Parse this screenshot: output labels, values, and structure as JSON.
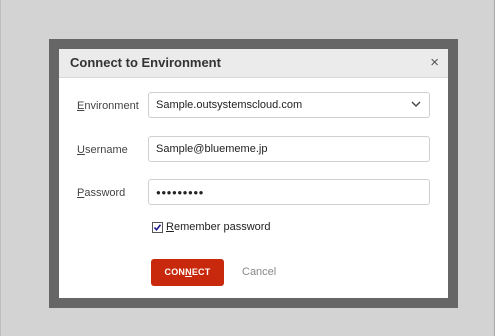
{
  "dialog": {
    "title": "Connect to Environment",
    "close_glyph": "×"
  },
  "form": {
    "environment": {
      "label_underlined": "E",
      "label_rest": "nvironment",
      "value": "Sample.outsystemscloud.com"
    },
    "username": {
      "label_underlined": "U",
      "label_rest": "sername",
      "value": "Sample@bluememe.jp"
    },
    "password": {
      "label_underlined": "P",
      "label_rest": "assword",
      "value": "●●●●●●●●●"
    },
    "remember": {
      "checked": true,
      "label_underlined": "R",
      "label_rest": "emember password"
    }
  },
  "actions": {
    "connect_pre": "CON",
    "connect_underlined": "N",
    "connect_post": "ECT",
    "cancel": "Cancel"
  },
  "colors": {
    "accent": "#c8280b",
    "overlay": "#666666",
    "background": "#d3d3d3"
  }
}
